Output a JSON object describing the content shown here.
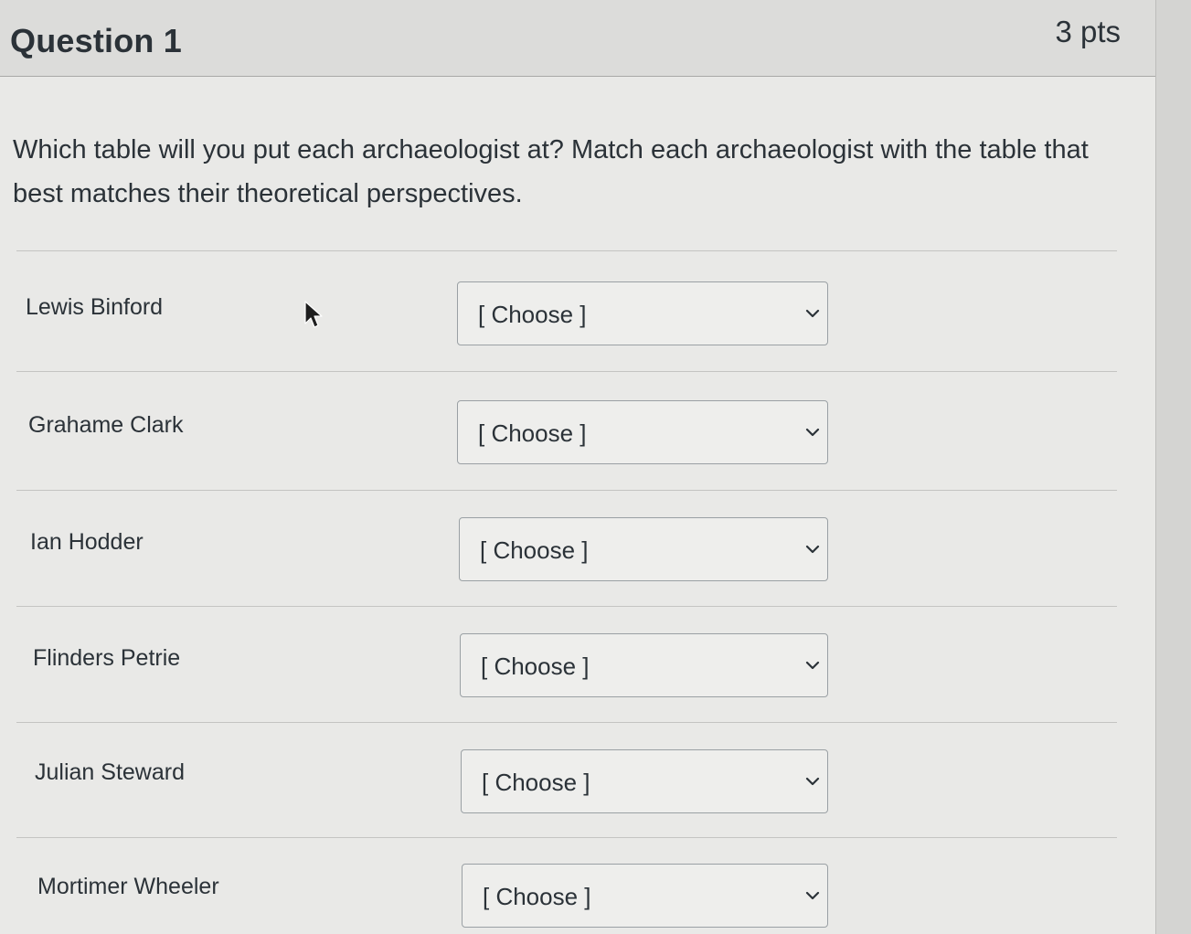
{
  "question": {
    "title": "Question 1",
    "points": "3 pts",
    "text": "Which table will you put each archaeologist at? Match each archaeologist with the table that best matches their theoretical perspectives."
  },
  "matches": [
    {
      "label": "Lewis Binford",
      "selected": "[ Choose ]"
    },
    {
      "label": "Grahame Clark",
      "selected": "[ Choose ]"
    },
    {
      "label": "Ian Hodder",
      "selected": "[ Choose ]"
    },
    {
      "label": "Flinders Petrie",
      "selected": "[ Choose ]"
    },
    {
      "label": "Julian Steward",
      "selected": "[ Choose ]"
    },
    {
      "label": "Mortimer Wheeler",
      "selected": "[ Choose ]"
    }
  ],
  "icons": {
    "dropdown": "chevron-down-icon",
    "pointer": "mouse-cursor-icon"
  },
  "colors": {
    "panel_background": "#e9e9e7",
    "header_background": "#dcdcda",
    "text": "#2b3238",
    "select_border": "#9aa0a4"
  }
}
